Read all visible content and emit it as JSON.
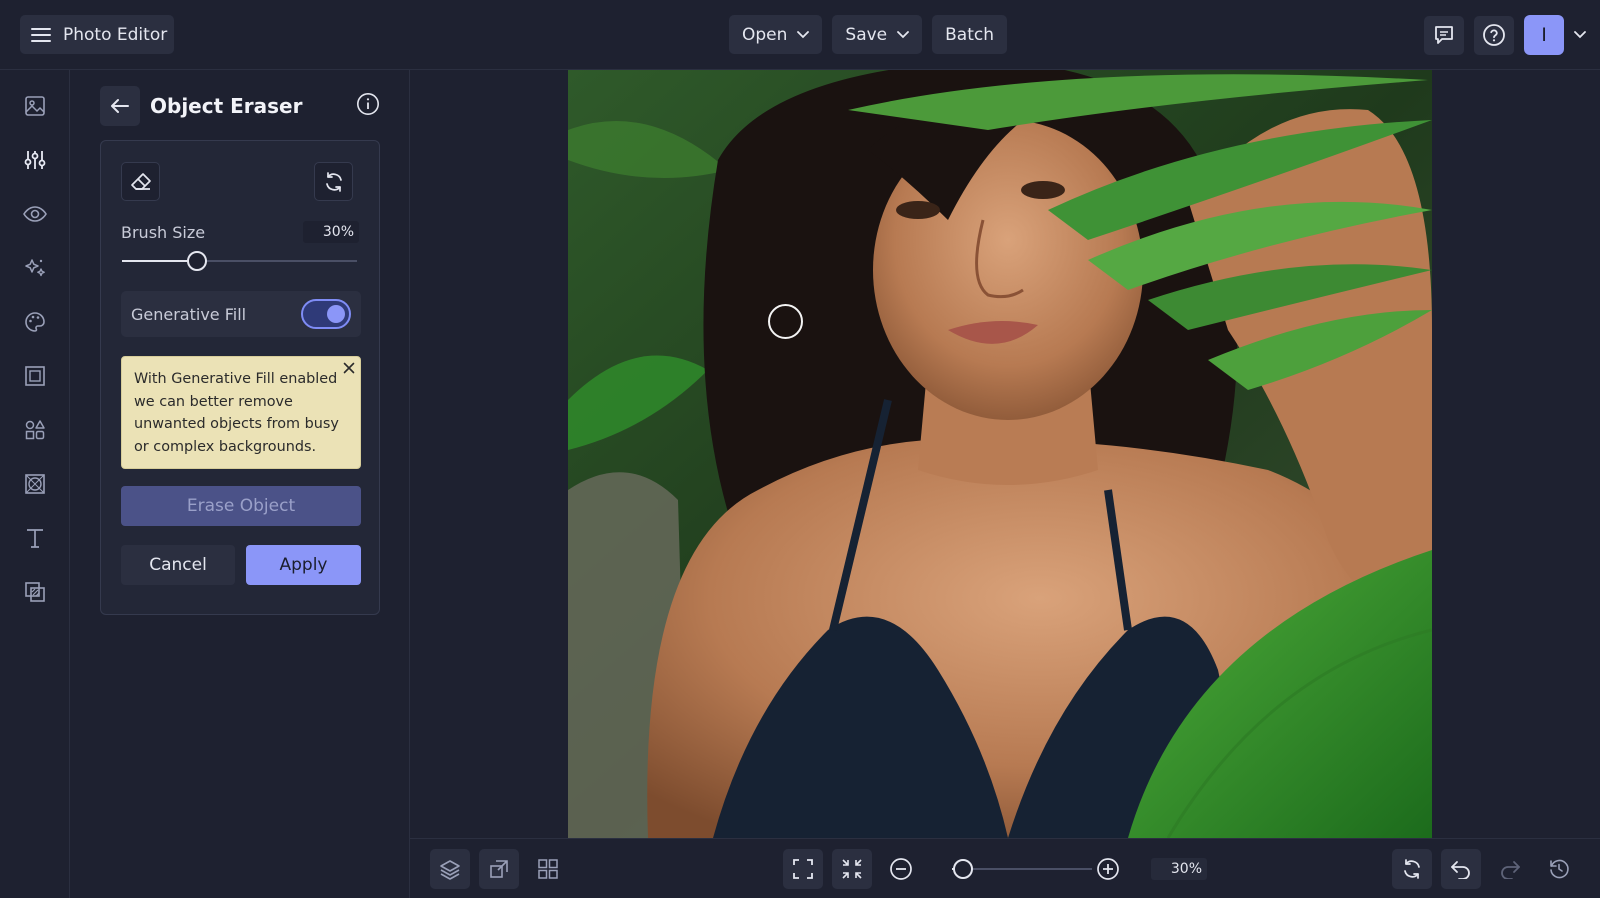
{
  "app": {
    "title": "Photo Editor",
    "menu_icon": "hamburger-icon"
  },
  "topbar": {
    "open_label": "Open",
    "save_label": "Save",
    "batch_label": "Batch",
    "avatar_initial": "I",
    "icons": [
      "comment-icon",
      "help-icon",
      "chevron-down-icon"
    ]
  },
  "rail": {
    "icons": [
      "image-icon",
      "adjustments-icon",
      "eye-icon",
      "sparkle-effects-icon",
      "palette-icon",
      "frame-icon",
      "graphics-icon",
      "texture-icon",
      "text-icon",
      "overlay-icon"
    ],
    "active": "adjustments-icon"
  },
  "panel": {
    "title": "Object Eraser",
    "brush_size_label": "Brush Size",
    "brush_size_value": "30%",
    "brush_size_fraction": 0.32,
    "generative_fill_label": "Generative Fill",
    "generative_fill_on": true,
    "tip_text": "With Generative Fill enabled we can better remove unwanted objects from busy or complex backgrounds.",
    "erase_label": "Erase Object",
    "cancel_label": "Cancel",
    "apply_label": "Apply"
  },
  "bottombar": {
    "zoom_value": "30%",
    "zoom_fraction": 0.05,
    "icons": [
      "layers-icon",
      "crop-resize-icon",
      "grid-icon",
      "fit-screen-icon",
      "actual-size-icon",
      "zoom-out-icon",
      "zoom-in-icon",
      "reset-icon",
      "undo-icon",
      "redo-icon",
      "history-icon"
    ]
  },
  "colors": {
    "background": "#1e2130",
    "surface": "#2b2f40",
    "accent": "#8b96f8",
    "tip_background": "#ebe2b6"
  }
}
